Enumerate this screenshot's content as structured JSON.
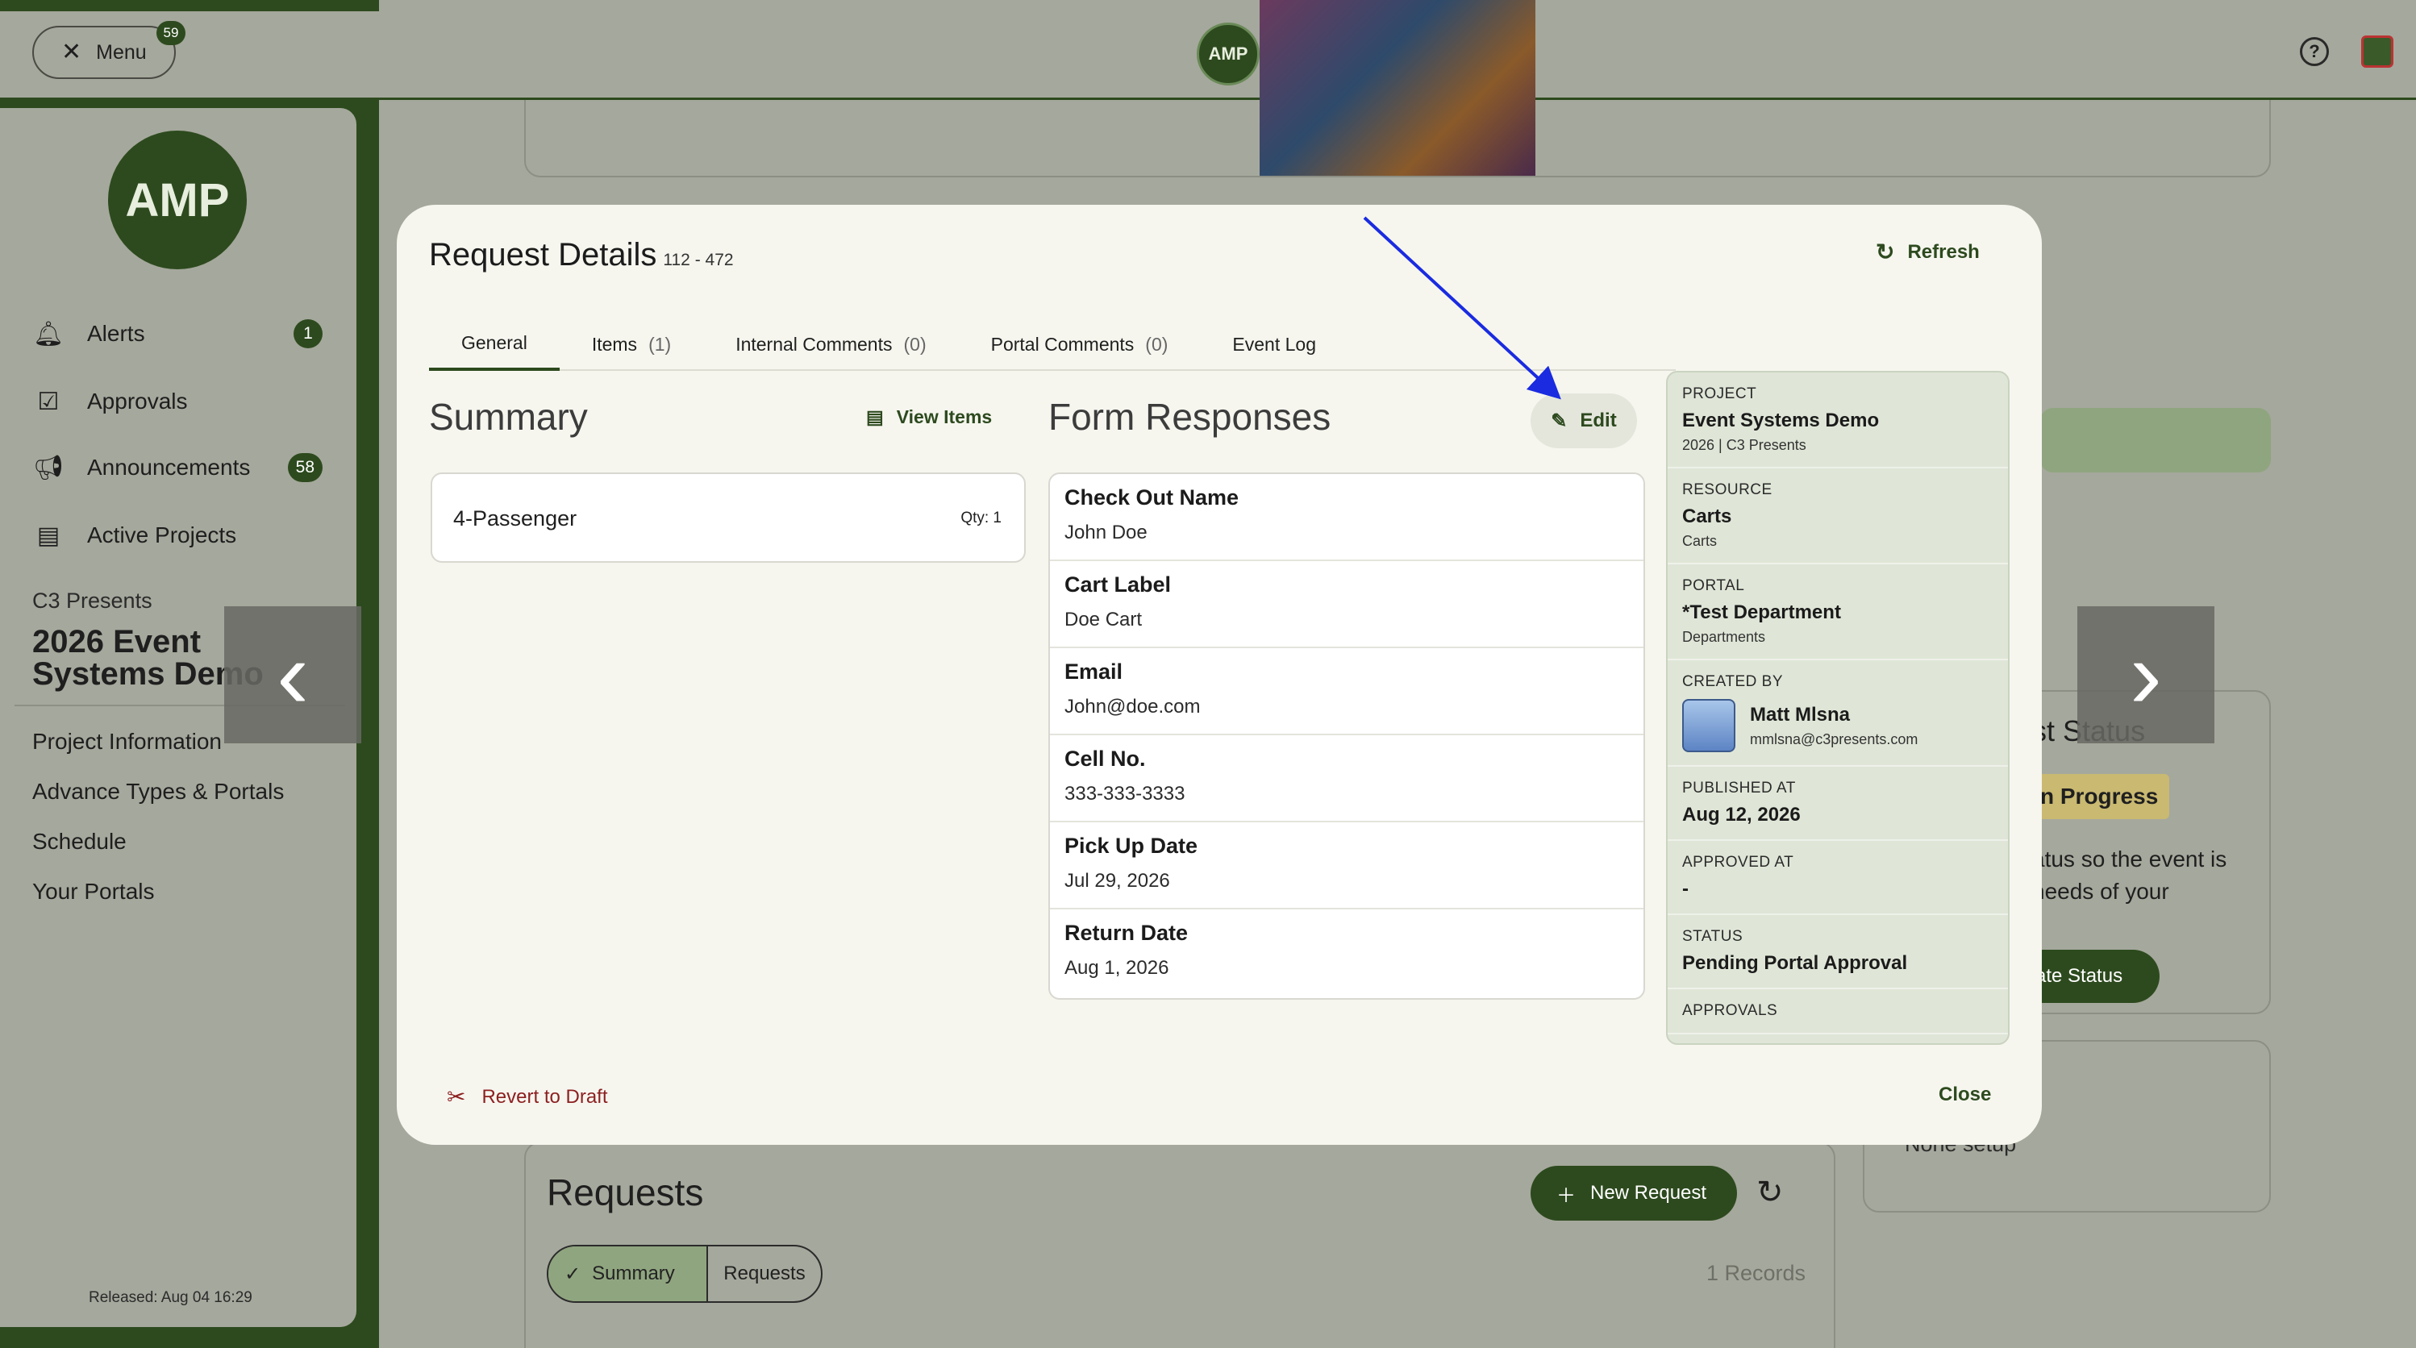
{
  "topbar": {
    "menu_label": "Menu",
    "menu_badge": "59",
    "logo_text": "AMP"
  },
  "sidebar": {
    "logo_text": "AMP",
    "nav": [
      {
        "label": "Alerts",
        "badge": "1"
      },
      {
        "label": "Approvals"
      },
      {
        "label": "Announcements",
        "badge": "58"
      },
      {
        "label": "Active Projects"
      }
    ],
    "org": "C3 Presents",
    "project": "2026 Event Systems Demo",
    "links": [
      "Project Information",
      "Advance Types & Portals",
      "Schedule",
      "Your Portals"
    ],
    "released": "Released: Aug 04 16:29"
  },
  "background": {
    "status_title": "st Status",
    "status_badge": "n Progress",
    "status_text": "atus so the event is needs of your",
    "update_button": "ate Status",
    "setup_text": "None setup",
    "requests_title": "Requests",
    "new_request": "New Request",
    "seg_summary": "Summary",
    "seg_requests": "Requests",
    "records": "1 Records"
  },
  "modal": {
    "title": "Request Details",
    "request_id": "112 - 472",
    "refresh_label": "Refresh",
    "tabs": [
      {
        "label": "General",
        "count": ""
      },
      {
        "label": "Items",
        "count": "(1)"
      },
      {
        "label": "Internal Comments",
        "count": "(0)"
      },
      {
        "label": "Portal Comments",
        "count": "(0)"
      },
      {
        "label": "Event Log",
        "count": ""
      }
    ],
    "summary_heading": "Summary",
    "view_items_label": "View Items",
    "item": {
      "name": "4-Passenger",
      "qty": "Qty: 1"
    },
    "form_heading": "Form Responses",
    "edit_label": "Edit",
    "form_fields": [
      {
        "label": "Check Out Name",
        "value": "John Doe"
      },
      {
        "label": "Cart Label",
        "value": "Doe Cart"
      },
      {
        "label": "Email",
        "value": "John@doe.com"
      },
      {
        "label": "Cell No.",
        "value": "333-333-3333"
      },
      {
        "label": "Pick Up Date",
        "value": "Jul 29, 2026"
      },
      {
        "label": "Return Date",
        "value": "Aug 1, 2026"
      }
    ],
    "info": {
      "project": {
        "caption": "PROJECT",
        "value": "Event Systems Demo",
        "sub": "2026 | C3 Presents"
      },
      "resource": {
        "caption": "RESOURCE",
        "value": "Carts",
        "sub": "Carts"
      },
      "portal": {
        "caption": "PORTAL",
        "value": "*Test Department",
        "sub": "Departments"
      },
      "created_by": {
        "caption": "CREATED BY",
        "name": "Matt Mlsna",
        "email": "mmlsna@c3presents.com"
      },
      "published": {
        "caption": "PUBLISHED AT",
        "value": "Aug 12, 2026"
      },
      "approved": {
        "caption": "APPROVED AT",
        "value": "-"
      },
      "status": {
        "caption": "STATUS",
        "value": "Pending Portal Approval"
      },
      "approvals": {
        "caption": "APPROVALS"
      }
    },
    "revert_label": "Revert to Draft",
    "close_label": "Close"
  },
  "colors": {
    "brand_green": "#2d4a1e",
    "revert_red": "#8c1f1f",
    "annotation_arrow": "#1a2be0"
  }
}
